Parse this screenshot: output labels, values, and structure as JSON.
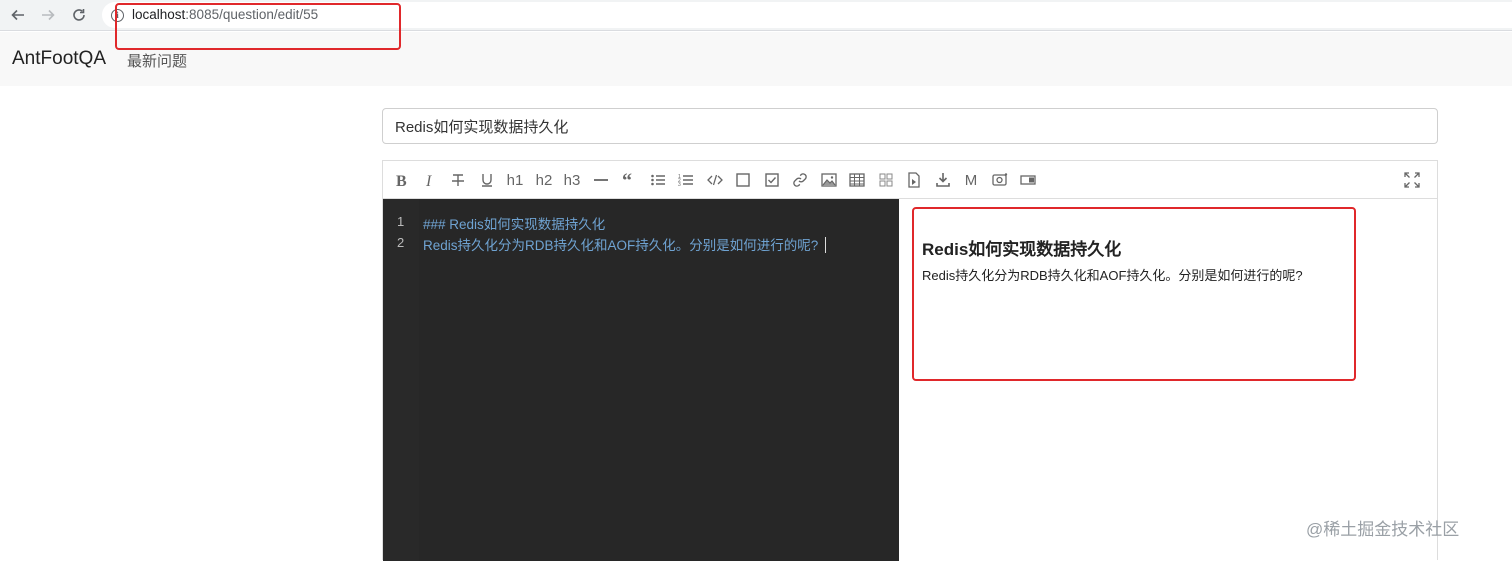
{
  "browser": {
    "url_host": "localhost",
    "url_rest": ":8085/question/edit/55"
  },
  "navbar": {
    "brand": "AntFootQA",
    "link": "最新问题"
  },
  "question": {
    "title_value": "Redis如何实现数据持久化"
  },
  "editor": {
    "toolbar": [
      "bold-icon",
      "italic-icon",
      "strikethrough-icon",
      "underline-icon",
      "h1",
      "h2",
      "h3",
      "hr-icon",
      "quote-icon",
      "unordered-list-icon",
      "ordered-list-icon",
      "code-icon",
      "checkbox-icon",
      "task-checked-icon",
      "link-icon",
      "image-icon",
      "table-icon",
      "grid-icon",
      "import-icon",
      "download-icon",
      "markdown-icon",
      "preview-eye-icon",
      "toggle-layout-icon",
      "fullscreen-icon"
    ],
    "toolbar_labels": {
      "h1": "h1",
      "h2": "h2",
      "h3": "h3",
      "m": "M"
    },
    "lines": [
      {
        "num": "1",
        "text": "### Redis如何实现数据持久化"
      },
      {
        "num": "2",
        "text": "Redis持久化分为RDB持久化和AOF持久化。分别是如何进行的呢?"
      }
    ],
    "preview": {
      "heading": "Redis如何实现数据持久化",
      "paragraph": "Redis持久化分为RDB持久化和AOF持久化。分别是如何进行的呢?"
    }
  },
  "annotation_color": "#e0282b",
  "watermark": "@稀土掘金技术社区"
}
